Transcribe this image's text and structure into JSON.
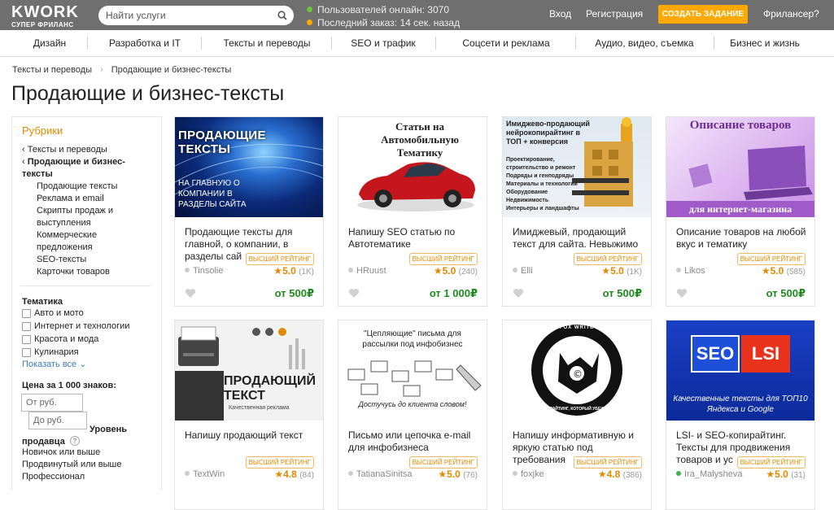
{
  "header": {
    "logo": "KWORK",
    "logo_sub": "СУПЕР ФРИЛАНС",
    "search_placeholder": "Найти услуги",
    "online_text": "Пользователей онлайн: 3070",
    "last_order_text": "Последний заказ: 14 сек. назад",
    "login": "Вход",
    "register": "Регистрация",
    "create_task": "СОЗДАТЬ ЗАДАНИЕ",
    "freelancer": "Фрилансер?",
    "online_dot_color": "#6ac73a",
    "order_dot_color": "#ffa800"
  },
  "categories": [
    "Дизайн",
    "Разработка и IT",
    "Тексты и переводы",
    "SEO и трафик",
    "Соцсети и реклама",
    "Аудио, видео, съемка",
    "Бизнес и жизнь"
  ],
  "breadcrumb": {
    "item1": "Тексты и переводы",
    "separator": "›",
    "item2": "Продающие и бизнес-тексты"
  },
  "page_title": "Продающие и бизнес-тексты",
  "sidebar": {
    "rubrics_title": "Рубрики",
    "parent": "Тексты и переводы",
    "current": "Продающие и бизнес-тексты",
    "subs": [
      "Продающие тексты",
      "Реклама и email",
      "Скрипты продаж и выступления",
      "Коммерческие предложения",
      "SEO-тексты",
      "Карточки товаров"
    ],
    "theme_title": "Тематика",
    "themes": [
      "Авто и мото",
      "Интернет и технологии",
      "Красота и мода",
      "Кулинария"
    ],
    "show_all": "Показать все",
    "price_title": "Цена за 1 000 знаков:",
    "price_from": "От руб.",
    "price_to": "До руб.",
    "level_title": "Уровень продавца",
    "levels": [
      "Новичок или выше",
      "Продвинутый или выше",
      "Профессионал"
    ]
  },
  "cards": [
    {
      "banner": "ПРОДАЮЩИЕ ТЕКСТЫ",
      "banner2": "НА ГЛАВНУЮ О КОМПАНИИ В РАЗДЕЛЫ САЙТА",
      "title": "Продающие тексты для главной, о компании, в разделы сай",
      "user": "Tinsolie",
      "badge": "ВЫСШИЙ РЕЙТИНГ",
      "rating": "5.0",
      "count": "(1K)",
      "price": "от 500₽"
    },
    {
      "banner": "Статьи на Автомобильную Тематику",
      "banner2": "",
      "title": "Напишу SEO статью по Автотематике",
      "user": "HRuust",
      "badge": "ВЫСШИЙ РЕЙТИНГ",
      "rating": "5.0",
      "count": "(240)",
      "price": "от 1 000₽"
    },
    {
      "banner": "Имиджево-продающий нейрокопирайтинг в ТОП + конверсия",
      "banner2": "Проектирование, строительство и ремонт Подряды и генподряды Материалы и технологии Оборудование Недвижимость Интерьеры и ландшафты",
      "title": "Имиджевый, продающий текст для сайта. Невыжимо",
      "user": "Elli",
      "badge": "ВЫСШИЙ РЕЙТИНГ",
      "rating": "5.0",
      "count": "(1K)",
      "price": "от 500₽"
    },
    {
      "banner": "Описание товаров",
      "banner2": "для интернет-магазина",
      "title": "Описание товаров на любой вкус и тематику",
      "user": "Likos",
      "badge": "ВЫСШИЙ РЕЙТИНГ",
      "rating": "5.0",
      "count": "(585)",
      "price": "от 500₽"
    },
    {
      "banner": "ПРОДАЮЩИЙ ТЕКСТ",
      "banner2": "Качественная реклама",
      "title": "Напишу продающий текст",
      "user": "TextWin",
      "badge": "ВЫСШИЙ РЕЙТИНГ",
      "rating": "4.8",
      "count": "(84)",
      "price": ""
    },
    {
      "banner": "\"Цепляющие\" письма для рассылки под инфобизнес",
      "banner2": "Достучусь до клиента словом!",
      "title": "Письмо или цепочка e-mail для инфобизнеса",
      "user": "TatianaSinitsa",
      "badge": "ВЫСШИЙ РЕЙТИНГ",
      "rating": "5.0",
      "count": "(76)",
      "price": ""
    },
    {
      "banner": "FOX WRITE",
      "banner2": "КОПИРАЙТИНГ, КОТОРЫЙ УБЕЖДАЕТ",
      "title": "Напишу информативную и яркую статью под требования",
      "user": "foxjke",
      "badge": "ВЫСШИЙ РЕЙТИНГ",
      "rating": "4.8",
      "count": "(386)",
      "price": ""
    },
    {
      "banner": "SEO",
      "banner2": "LSI",
      "banner3": "Качественные тексты для ТОП10 Яндекса и Google",
      "title": "LSI- и SEO-копирайтинг. Тексты для продвижения товаров и ус",
      "user": "Ira_Malysheva",
      "badge": "ВЫСШИЙ РЕЙТИНГ",
      "rating": "5.0",
      "count": "(31)",
      "price": ""
    }
  ]
}
